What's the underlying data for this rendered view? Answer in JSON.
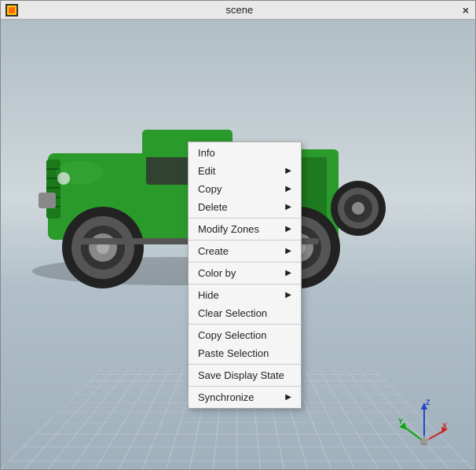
{
  "window": {
    "title": "scene",
    "close_label": "×"
  },
  "context_menu": {
    "items": [
      {
        "id": "info",
        "label": "Info",
        "has_arrow": false,
        "separator_after": false
      },
      {
        "id": "edit",
        "label": "Edit",
        "has_arrow": true,
        "separator_after": false
      },
      {
        "id": "copy",
        "label": "Copy",
        "has_arrow": true,
        "separator_after": false
      },
      {
        "id": "delete",
        "label": "Delete",
        "has_arrow": true,
        "separator_after": true
      },
      {
        "id": "modify-zones",
        "label": "Modify Zones",
        "has_arrow": true,
        "separator_after": true
      },
      {
        "id": "create",
        "label": "Create",
        "has_arrow": true,
        "separator_after": true
      },
      {
        "id": "color-by",
        "label": "Color by",
        "has_arrow": true,
        "separator_after": true
      },
      {
        "id": "hide",
        "label": "Hide",
        "has_arrow": true,
        "separator_after": false
      },
      {
        "id": "clear-selection",
        "label": "Clear Selection",
        "has_arrow": false,
        "separator_after": true
      },
      {
        "id": "copy-selection",
        "label": "Copy Selection",
        "has_arrow": false,
        "separator_after": false
      },
      {
        "id": "paste-selection",
        "label": "Paste Selection",
        "has_arrow": false,
        "separator_after": true
      },
      {
        "id": "save-display-state",
        "label": "Save Display State",
        "has_arrow": false,
        "separator_after": true
      },
      {
        "id": "synchronize",
        "label": "Synchronize",
        "has_arrow": true,
        "separator_after": false
      }
    ]
  },
  "axes": {
    "x_color": "#ff0000",
    "y_color": "#00aa00",
    "z_color": "#0000ff"
  }
}
